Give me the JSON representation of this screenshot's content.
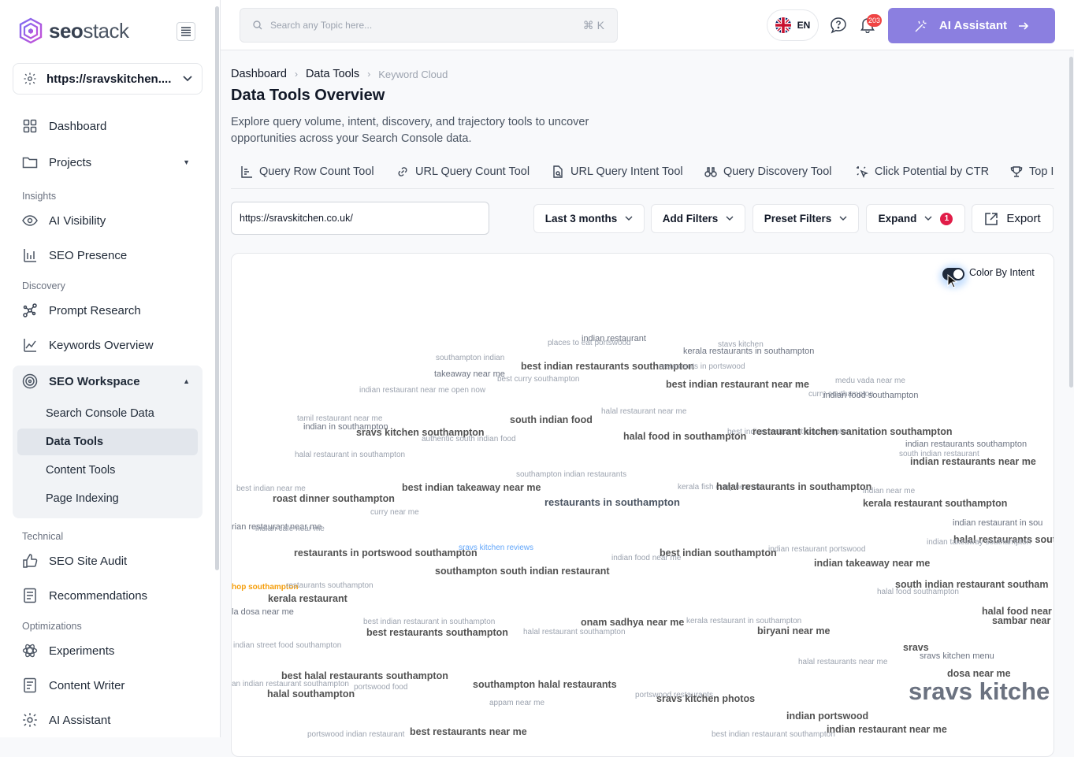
{
  "app": {
    "brand_bold": "seo",
    "brand_light": "stack"
  },
  "sidebar": {
    "site": "https://sravskitchen....",
    "items": {
      "dashboard": "Dashboard",
      "projects": "Projects",
      "insights_label": "Insights",
      "ai_visibility": "AI Visibility",
      "seo_presence": "SEO Presence",
      "discovery_label": "Discovery",
      "prompt_research": "Prompt Research",
      "keywords_overview": "Keywords Overview",
      "seo_workspace": "SEO Workspace",
      "search_console_data": "Search Console Data",
      "data_tools": "Data Tools",
      "content_tools": "Content Tools",
      "page_indexing": "Page Indexing",
      "technical_label": "Technical",
      "seo_site_audit": "SEO Site Audit",
      "recommendations": "Recommendations",
      "optimizations_label": "Optimizations",
      "experiments": "Experiments",
      "content_writer": "Content Writer",
      "ai_assistant": "AI Assistant"
    }
  },
  "topbar": {
    "search_placeholder": "Search any Topic here...",
    "shortcut": "⌘ K",
    "language": "EN",
    "notifications": "203",
    "ai_button": "AI Assistant"
  },
  "breadcrumb": {
    "a": "Dashboard",
    "b": "Data Tools",
    "c": "Keyword Cloud"
  },
  "page": {
    "title": "Data Tools Overview",
    "description": "Explore query volume, intent, discovery, and trajectory tools to uncover opportunities across your Search Console data."
  },
  "tabs": [
    "Query Row Count Tool",
    "URL Query Count Tool",
    "URL Query Intent Tool",
    "Query Discovery Tool",
    "Click Potential by CTR",
    "Top I"
  ],
  "controls": {
    "url": "https://sravskitchen.co.uk/",
    "date_range": "Last 3 months",
    "add_filters": "Add Filters",
    "preset_filters": "Preset Filters",
    "expand": "Expand",
    "expand_count": "1",
    "export": "Export"
  },
  "cloud": {
    "toggle_label": "Color By Intent",
    "toggle_on": true,
    "words": [
      "indian restaurant",
      "places to eat portswood",
      "stavs kitchen",
      "kerala restaurants in southampton",
      "southampton indian",
      "best indian restaurants southampton",
      "restaurants in portswood",
      "takeaway near me",
      "best curry southampton",
      "indian restaurant near me open now",
      "best indian restaurant near me",
      "medu vada near me",
      "curry southampton",
      "indian food southampton",
      "tamil restaurant near me",
      "south indian food",
      "halal restaurant near me",
      "indian in southampton",
      "sravs kitchen southampton",
      "authentic south indian food",
      "halal food in southampton",
      "best indian restaurant southampton",
      "restaurant kitchen sanitation southampton",
      "indian restaurants southampton",
      "halal restaurant in southampton",
      "south indian restaurant",
      "indian restaurants near me",
      "southampton indian restaurants",
      "best indian near me",
      "best indian takeaway near me",
      "kerala fish curry near me",
      "halal restaurants in southampton",
      "indian near me",
      "roast dinner southampton",
      "restaurants in southampton",
      "kerala restaurant southampton",
      "curry near me",
      "indian restaurant in sou",
      "rian restaurant near me",
      "indian cafe near me",
      "halal restaurants sout",
      "sravs kitchen reviews",
      "indian takeaway southampton",
      "restaurants in portswood southampton",
      "best indian southampton",
      "indian restaurant portswood",
      "indian food near me",
      "indian takeaway near me",
      "southampton south indian restaurant",
      "hop southampton",
      "restaurants southampton",
      "south indian restaurant southam",
      "halal food southampton",
      "kerala restaurant",
      "halal food near",
      "sambar near",
      "la dosa near me",
      "best indian restaurant in southampton",
      "onam sadhya near me",
      "kerala restaurant in southampton",
      "best restaurants southampton",
      "halal restaurant southampton",
      "biryani near me",
      "indian street food southampton",
      "sravs",
      "sravs kitchen menu",
      "halal restaurants near me",
      "best halal restaurants southampton",
      "dosa near me",
      "an indian restaurant southampton",
      "portswood food",
      "southampton halal restaurants",
      "sravs kitche",
      "halal southampton",
      "portswood restaurants",
      "sravs kitchen photos",
      "appam near me",
      "indian portswood",
      "portswood indian restaurant",
      "best restaurants near me",
      "best indian restaurant southampton",
      "indian restaurant near me"
    ]
  }
}
